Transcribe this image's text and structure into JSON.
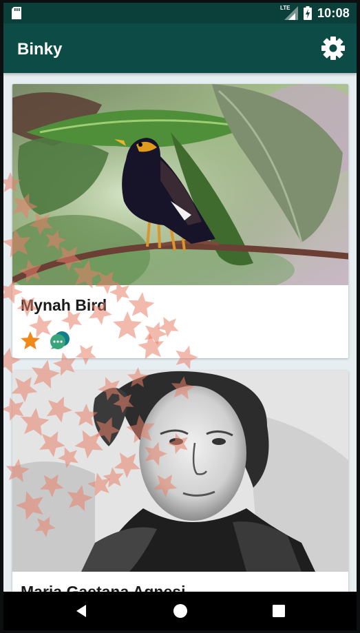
{
  "status": {
    "network": "LTE",
    "time": "10:08"
  },
  "app": {
    "title": "Binky"
  },
  "cards": [
    {
      "title": "Mynah Bird",
      "favorite": "star-icon",
      "chat": "chat-bubbles-icon"
    },
    {
      "title": "Maria Gaetana Agnesi"
    }
  ],
  "colors": {
    "status_bar": "#0b3f3a",
    "app_bar": "#0d4c46",
    "background": "#e6eef2",
    "star": "#ef8a1a",
    "confetti": "#e8806a"
  },
  "nav": {
    "back": "back-icon",
    "home": "home-icon",
    "recents": "recents-icon"
  }
}
